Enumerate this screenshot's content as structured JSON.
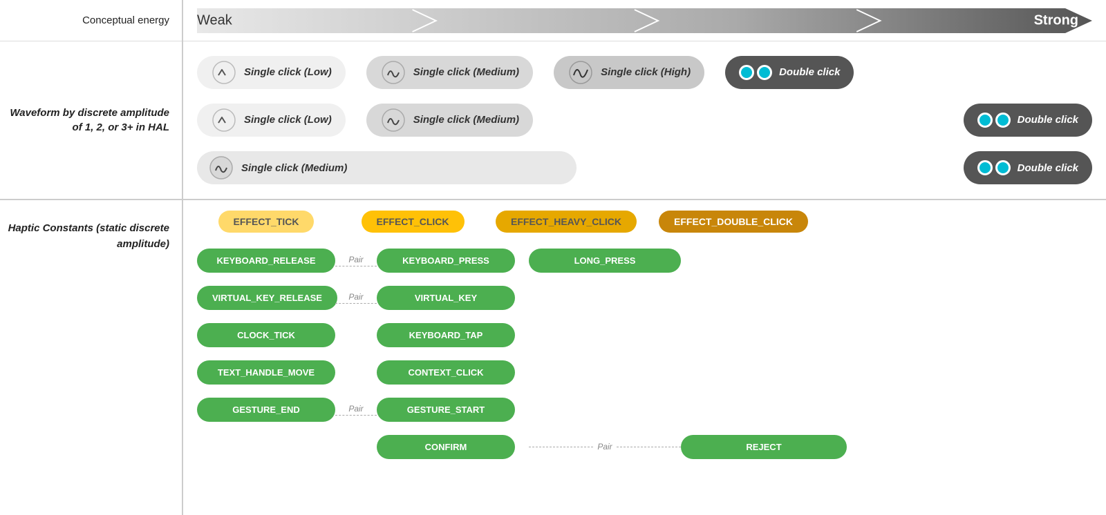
{
  "labels": {
    "conceptual_energy": "Conceptual energy",
    "weak": "Weak",
    "strong": "Strong",
    "waveform_label": "Waveform by discrete amplitude of 1, 2, or 3+ in HAL",
    "haptic_label": "Haptic Constants (static discrete amplitude)"
  },
  "waveform_rows": [
    {
      "pills": [
        {
          "type": "light",
          "wave": "low",
          "text": "Single click (Low)"
        },
        {
          "type": "medium",
          "wave": "med",
          "text": "Single click (Medium)"
        },
        {
          "type": "medium",
          "wave": "high",
          "text": "Single click (High)"
        },
        {
          "type": "dark",
          "wave": "double",
          "text": "Double click"
        }
      ]
    },
    {
      "pills": [
        {
          "type": "light",
          "wave": "low",
          "text": "Single click (Low)"
        },
        {
          "type": "medium",
          "wave": "med",
          "text": "Single click (Medium)"
        },
        {
          "type": "dark",
          "wave": "double",
          "text": "Double click"
        }
      ]
    },
    {
      "pills": [
        {
          "type": "medium-wide",
          "wave": "med",
          "text": "Single click (Medium)"
        },
        {
          "type": "dark",
          "wave": "double",
          "text": "Double click"
        }
      ]
    }
  ],
  "effects": [
    {
      "label": "EFFECT_TICK",
      "color": "yellow-light"
    },
    {
      "label": "EFFECT_CLICK",
      "color": "yellow-mid"
    },
    {
      "label": "EFFECT_HEAVY_CLICK",
      "color": "yellow-dark"
    },
    {
      "label": "EFFECT_DOUBLE_CLICK",
      "color": "gold"
    }
  ],
  "haptic_constants": {
    "col_tick": [
      "KEYBOARD_RELEASE",
      "VIRTUAL_KEY_RELEASE",
      "CLOCK_TICK",
      "TEXT_HANDLE_MOVE",
      "GESTURE_END"
    ],
    "col_click": [
      "KEYBOARD_PRESS",
      "VIRTUAL_KEY",
      "KEYBOARD_TAP",
      "CONTEXT_CLICK",
      "GESTURE_START",
      "CONFIRM"
    ],
    "col_heavy": [
      "LONG_PRESS"
    ],
    "col_double": [
      "REJECT"
    ],
    "pairs": [
      {
        "from": "KEYBOARD_RELEASE",
        "to": "KEYBOARD_PRESS"
      },
      {
        "from": "VIRTUAL_KEY_RELEASE",
        "to": "VIRTUAL_KEY"
      },
      {
        "from": "GESTURE_END",
        "to": "GESTURE_START"
      },
      {
        "from": "CONFIRM",
        "to": "REJECT"
      }
    ],
    "pair_label": "Pair"
  }
}
